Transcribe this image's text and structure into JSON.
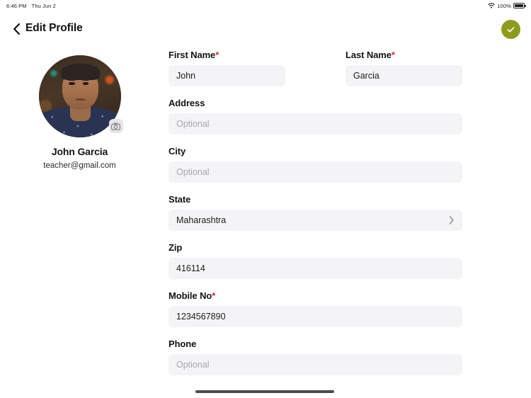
{
  "status_bar": {
    "time": "6:46 PM",
    "date": "Thu Jun 2",
    "battery_percent": "100%",
    "wifi_icon": "wifi-icon",
    "battery_icon": "battery-full-icon"
  },
  "header": {
    "back_icon": "chevron-left-icon",
    "title": "Edit Profile",
    "save_icon": "check-icon",
    "save_color": "#8e9c1d"
  },
  "profile": {
    "avatar_alt": "avatar",
    "camera_icon": "camera-icon",
    "name": "John Garcia",
    "email": "teacher@gmail.com"
  },
  "form": {
    "required_marker": "*",
    "fields": [
      {
        "name": "first-name",
        "label": "First Name",
        "required": true,
        "value": "John",
        "placeholder": "Optional",
        "is_placeholder": false
      },
      {
        "name": "last-name",
        "label": "Last Name",
        "required": true,
        "value": "Garcia",
        "placeholder": "Optional",
        "is_placeholder": false
      },
      {
        "name": "address",
        "label": "Address",
        "required": false,
        "value": "Optional",
        "placeholder": "Optional",
        "is_placeholder": true
      },
      {
        "name": "city",
        "label": "City",
        "required": false,
        "value": "Optional",
        "placeholder": "Optional",
        "is_placeholder": true
      },
      {
        "name": "state",
        "label": "State",
        "required": false,
        "value": "Maharashtra",
        "placeholder": "Optional",
        "is_placeholder": false,
        "chevron_icon": "chevron-right-icon"
      },
      {
        "name": "zip",
        "label": "Zip",
        "required": false,
        "value": "416114",
        "placeholder": "Optional",
        "is_placeholder": false
      },
      {
        "name": "mobile-no",
        "label": "Mobile No",
        "required": true,
        "value": "1234567890",
        "placeholder": "Optional",
        "is_placeholder": false
      },
      {
        "name": "phone",
        "label": "Phone",
        "required": false,
        "value": "Optional",
        "placeholder": "Optional",
        "is_placeholder": true
      }
    ]
  },
  "home_indicator": "home-indicator"
}
